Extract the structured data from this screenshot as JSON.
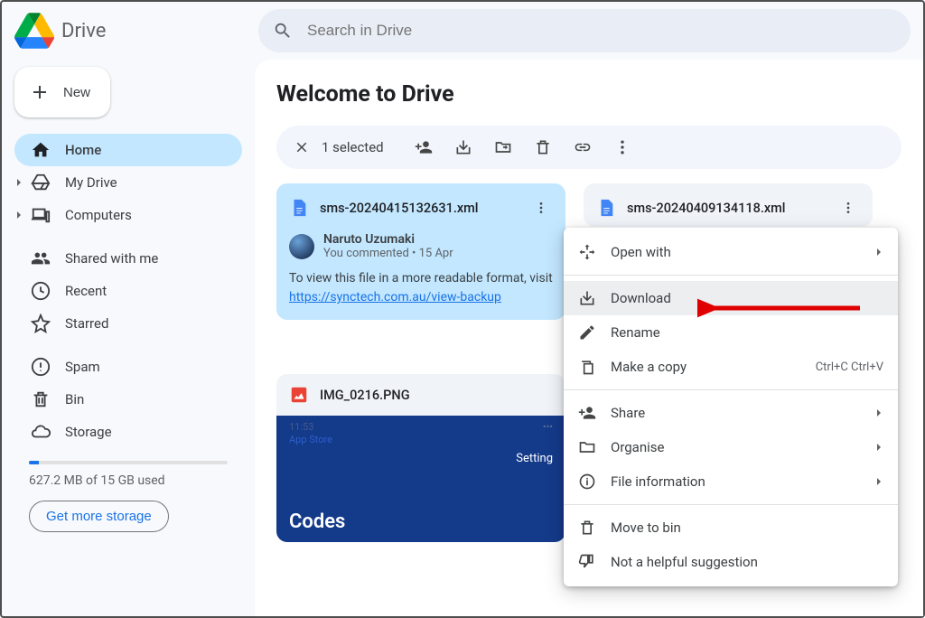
{
  "header": {
    "app_name": "Drive",
    "search_placeholder": "Search in Drive"
  },
  "sidebar": {
    "new_label": "New",
    "items": [
      {
        "label": "Home"
      },
      {
        "label": "My Drive"
      },
      {
        "label": "Computers"
      }
    ],
    "items2": [
      {
        "label": "Shared with me"
      },
      {
        "label": "Recent"
      },
      {
        "label": "Starred"
      }
    ],
    "items3": [
      {
        "label": "Spam"
      },
      {
        "label": "Bin"
      },
      {
        "label": "Storage"
      }
    ],
    "storage_used_pct": 4.2,
    "storage_text": "627.2 MB of 15 GB used",
    "get_more": "Get more storage"
  },
  "main": {
    "title": "Welcome to Drive",
    "selection_text": "1 selected"
  },
  "cards": {
    "file1_name": "sms-20240415132631.xml",
    "comment_author": "Naruto Uzumaki",
    "comment_sub": "You commented • 15 Apr",
    "comment_msg": "To view this file in a more readable format, visit ",
    "comment_link": "https://synctech.com.au/view-backup",
    "file2_name": "sms-20240409134118.xml",
    "file3_name": "IMG_0216.PNG",
    "preview_time": "11:53",
    "preview_appstore": "App Store",
    "preview_settings": "Setting",
    "preview_codes": "Codes"
  },
  "ctx": {
    "open_with": "Open with",
    "download": "Download",
    "rename": "Rename",
    "make_copy": "Make a copy",
    "make_copy_shortcut": "Ctrl+C Ctrl+V",
    "share": "Share",
    "organise": "Organise",
    "file_info": "File information",
    "move_to_bin": "Move to bin",
    "not_helpful": "Not a helpful suggestion"
  }
}
